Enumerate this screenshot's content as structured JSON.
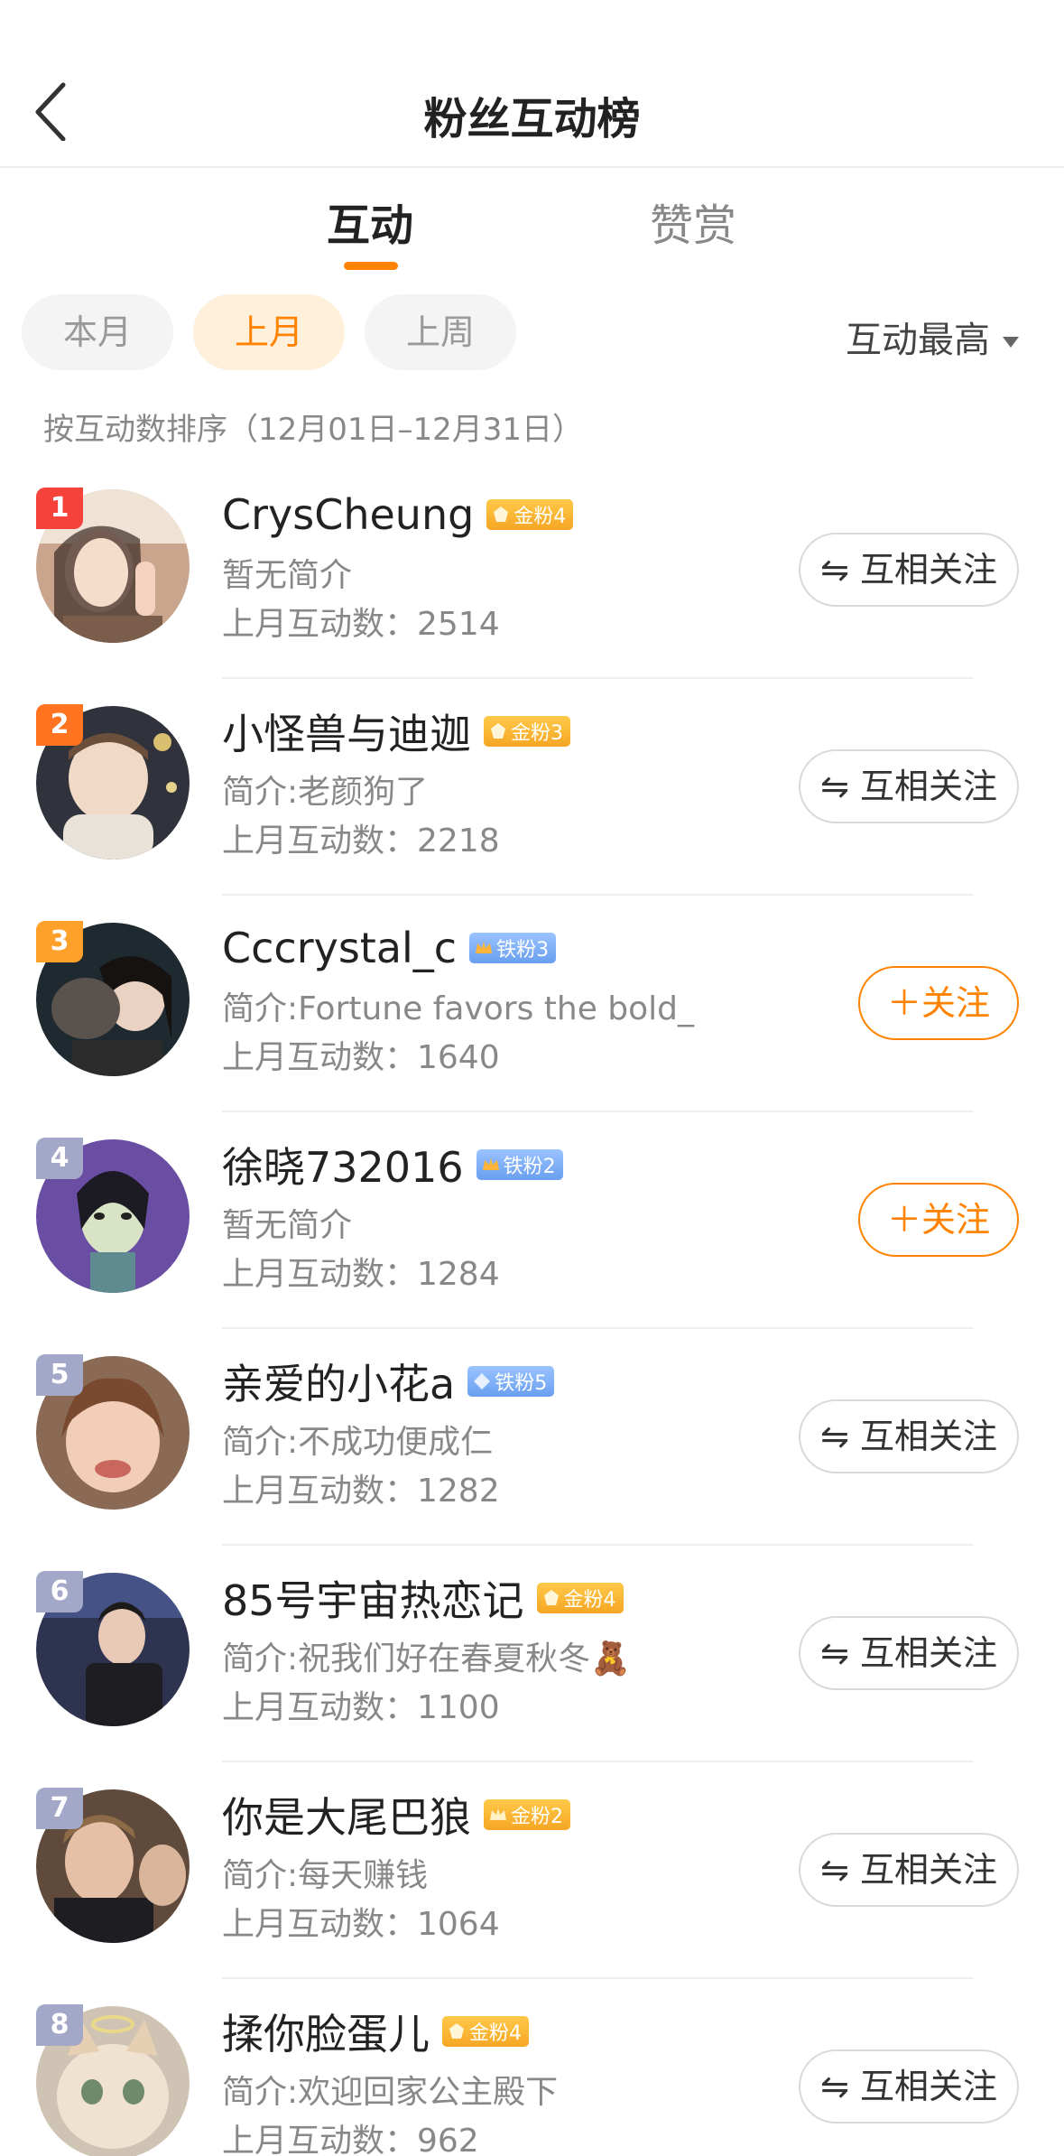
{
  "nav": {
    "title": "粉丝互动榜"
  },
  "tabs": [
    {
      "label": "互动",
      "active": true
    },
    {
      "label": "赞赏",
      "active": false
    }
  ],
  "filters": {
    "chips": [
      {
        "label": "本月",
        "active": false
      },
      {
        "label": "上月",
        "active": true
      },
      {
        "label": "上周",
        "active": false
      }
    ],
    "sort_label": "互动最高"
  },
  "range_text": "按互动数排序（12月01日–12月31日）",
  "colors": {
    "accent": "#ff8200",
    "rank_1": "#f5433c",
    "rank_2": "#ff7321",
    "rank_3": "#ffa02a",
    "rank_other": "#a3a8c9"
  },
  "fans": [
    {
      "rank": "1",
      "name": "CrysCheung",
      "badge": "金粉4",
      "badge_type": "gold",
      "bio": "暂无简介",
      "count": "上月互动数：2514",
      "button": "⇋ 互相关注",
      "button_type": "mutual"
    },
    {
      "rank": "2",
      "name": "小怪兽与迪迦",
      "badge": "金粉3",
      "badge_type": "gold",
      "bio": "简介:老颜狗了",
      "count": "上月互动数：2218",
      "button": "⇋ 互相关注",
      "button_type": "mutual"
    },
    {
      "rank": "3",
      "name": "Cccrystal_c",
      "badge": "铁粉3",
      "badge_type": "iron",
      "bio": "简介:Fortune favors the bold_",
      "count": "上月互动数：1640",
      "button": "＋关注",
      "button_type": "follow"
    },
    {
      "rank": "4",
      "name": "徐晓732016",
      "badge": "铁粉2",
      "badge_type": "iron",
      "bio": "暂无简介",
      "count": "上月互动数：1284",
      "button": "＋关注",
      "button_type": "follow"
    },
    {
      "rank": "5",
      "name": "亲爱的小花a",
      "badge": "铁粉5",
      "badge_type": "iron",
      "bio": "简介:不成功便成仁",
      "count": "上月互动数：1282",
      "button": "⇋ 互相关注",
      "button_type": "mutual"
    },
    {
      "rank": "6",
      "name": "85号宇宙热恋记",
      "badge": "金粉4",
      "badge_type": "gold",
      "bio": "简介:祝我们好在春夏秋冬🧸",
      "count": "上月互动数：1100",
      "button": "⇋ 互相关注",
      "button_type": "mutual"
    },
    {
      "rank": "7",
      "name": "你是大尾巴狼",
      "badge": "金粉2",
      "badge_type": "gold",
      "bio": "简介:每天赚钱",
      "count": "上月互动数：1064",
      "button": "⇋ 互相关注",
      "button_type": "mutual"
    },
    {
      "rank": "8",
      "name": "揉你脸蛋儿",
      "badge": "金粉4",
      "badge_type": "gold",
      "bio": "简介:欢迎回家公主殿下",
      "count": "上月互动数：962",
      "button": "⇋ 互相关注",
      "button_type": "mutual"
    }
  ]
}
